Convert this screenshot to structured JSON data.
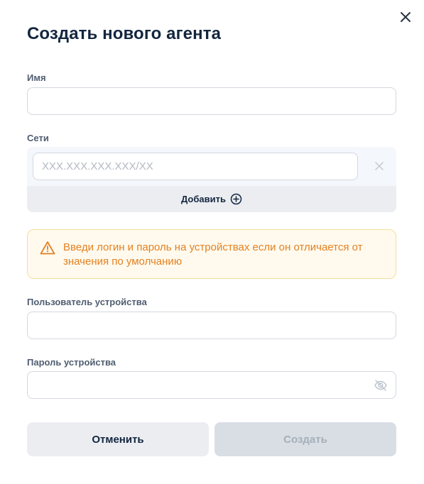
{
  "dialog": {
    "title": "Создать нового агента",
    "close_icon": "close-icon"
  },
  "fields": {
    "name": {
      "label": "Имя",
      "value": "",
      "placeholder": ""
    },
    "networks": {
      "label": "Сети",
      "input": {
        "value": "",
        "placeholder": "XXX.XXX.XXX.XXX/XX"
      },
      "clear_icon": "close-icon",
      "add_label": "Добавить",
      "add_icon": "plus-circle-icon"
    },
    "device_user": {
      "label": "Пользователь устройства",
      "value": "",
      "placeholder": ""
    },
    "device_password": {
      "label": "Пароль устройства",
      "value": "",
      "placeholder": "",
      "visibility_icon": "eye-off-icon"
    }
  },
  "warning": {
    "icon": "warning-triangle-icon",
    "text": "Введи логин и пароль на устройствах если он отличается от значения по умолчанию"
  },
  "buttons": {
    "cancel": "Отменить",
    "create": "Создать"
  },
  "colors": {
    "title": "#13263f",
    "warning_text": "#e38123",
    "warning_bg": "#fffaed",
    "warning_border": "#f6dd9c",
    "create_disabled_bg": "#d9dee5",
    "cancel_bg": "#ebedf1"
  }
}
